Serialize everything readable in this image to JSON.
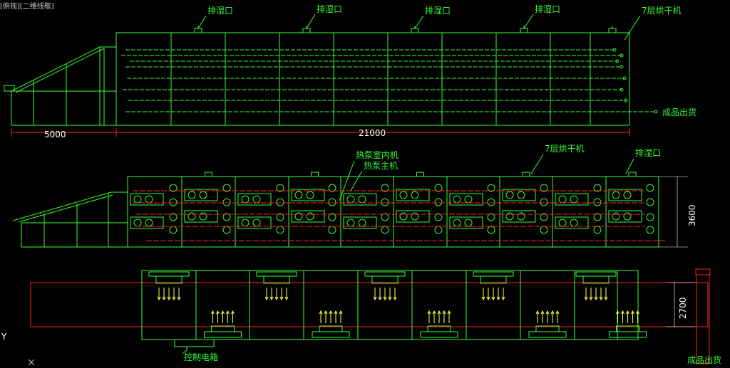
{
  "viewport_label": "[俯视][二维线框]",
  "top_view": {
    "exhaust_label": "排湿口",
    "dryer_label": "7层烘干机",
    "output_label": "成品出货",
    "dim_left": "5000",
    "dim_right": "21000"
  },
  "side_view": {
    "indoor_label": "热泵室内机",
    "main_label": "热泵主机",
    "dryer_label": "7层烘干机",
    "exhaust_label": "排湿口",
    "dim_height": "3600"
  },
  "plan_view": {
    "control_label": "控制电箱",
    "dim_width": "2700",
    "output_label": "成品出货"
  },
  "axis_label": "Y",
  "colors": {
    "green": "#33ff33",
    "red": "#ff2222",
    "yellow": "#ffff44",
    "white": "#ffffff"
  }
}
